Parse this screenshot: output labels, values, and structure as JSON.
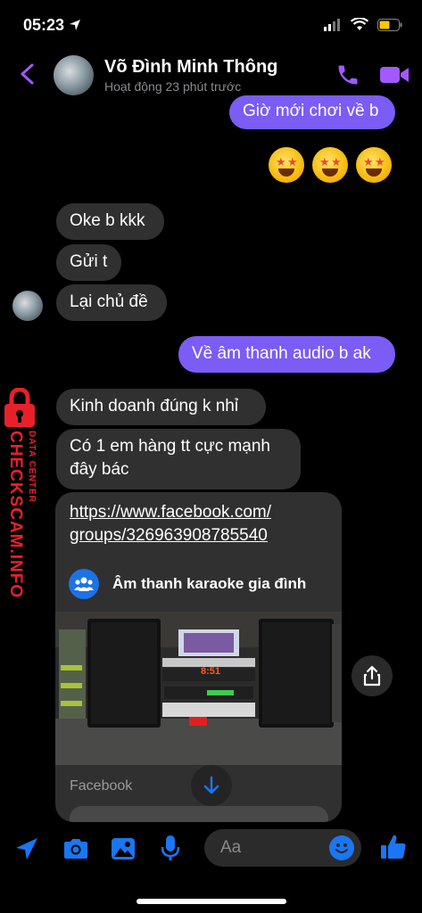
{
  "status_bar": {
    "time": "05:23"
  },
  "header": {
    "name": "Võ Đình Minh Thông",
    "status": "Hoạt động 23 phút trước"
  },
  "messages": {
    "out_1": "Giờ mới chơi về b",
    "in_1": "Oke b kkk",
    "in_2": "Gửi t",
    "in_3": "Lại chủ đề",
    "out_2": "Về âm thanh audio b ak",
    "in_4": "Kinh doanh đúng k nhỉ",
    "in_5_line1": "Có 1 em hàng tt cực mạnh",
    "in_5_line2": "đây bác"
  },
  "link_card": {
    "url_line1": "https://www.facebook.com/",
    "url_line2": "groups/326963908785540",
    "group_name": "Âm thanh karaoke gia đình",
    "source": "Facebook",
    "amp_display": "8:51"
  },
  "watermark": {
    "brand": "CHECKSCAM.INFO",
    "tag": "DATA CENTER"
  },
  "composer": {
    "placeholder": "Aa"
  },
  "colors": {
    "accent": "#7b5cf5",
    "header_icons": "#a259ff",
    "toolbar_icons": "#1a76f2",
    "incoming_bubble": "#303030",
    "watermark_red": "#e8202a"
  }
}
